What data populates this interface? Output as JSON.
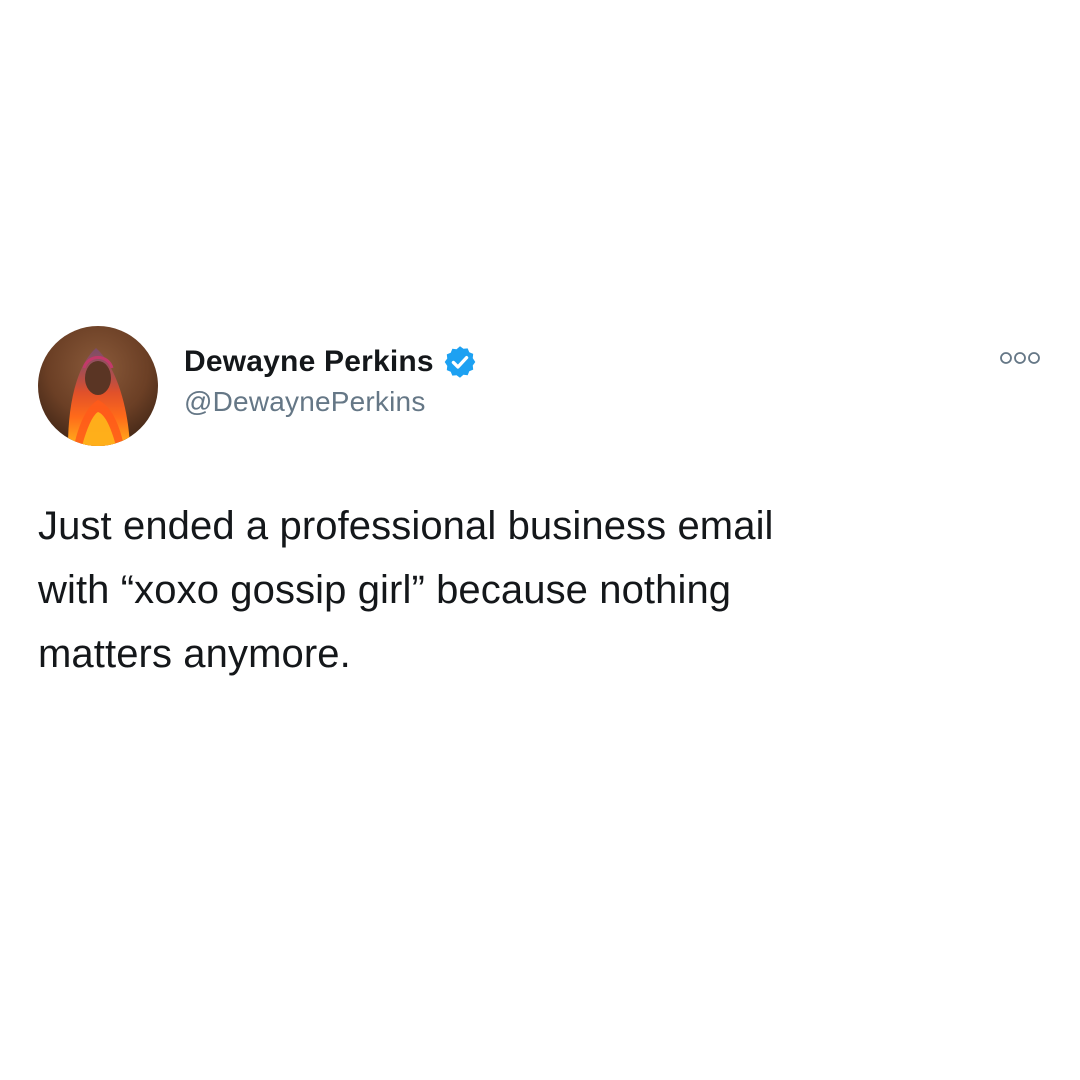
{
  "tweet": {
    "author": {
      "display_name": "Dewayne Perkins",
      "handle": "@DewaynePerkins",
      "verified": true,
      "avatar_icon": "profile-photo"
    },
    "text": "Just ended a professional business email\nwith “xoxo gossip girl” because nothing\nmatters anymore.",
    "more_icon": "more-options-icon"
  },
  "colors": {
    "background": "#ffffff",
    "text": "#14171a",
    "secondary_text": "#657786",
    "verified_badge": "#1da1f2"
  }
}
